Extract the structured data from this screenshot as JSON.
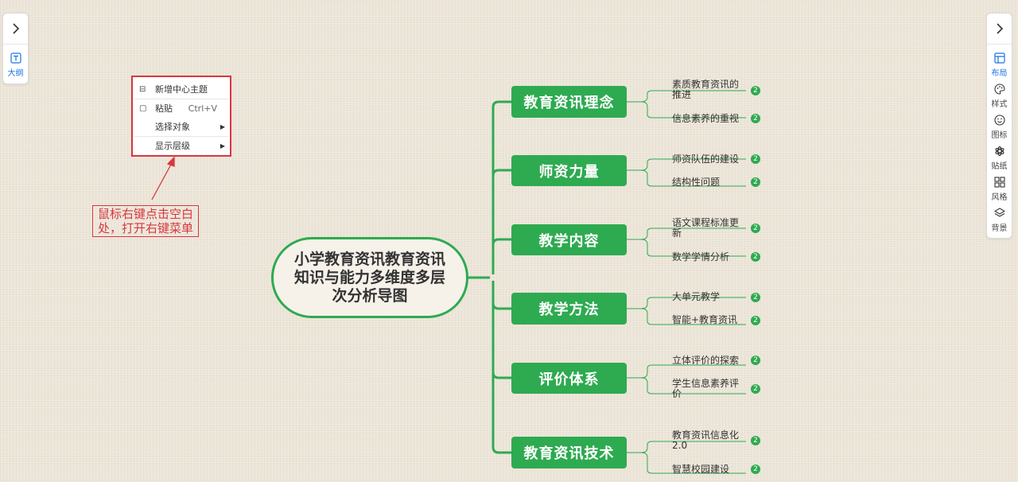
{
  "left_panel": {
    "expand_icon": "chevron-right-icon",
    "outline_label": "大纲"
  },
  "right_panel": {
    "expand_icon": "chevron-right-icon",
    "tools": [
      {
        "label": "布局",
        "icon": "layout-icon",
        "active": true
      },
      {
        "label": "样式",
        "icon": "palette-icon",
        "active": false
      },
      {
        "label": "图标",
        "icon": "smiley-icon",
        "active": false
      },
      {
        "label": "贴纸",
        "icon": "sticker-icon",
        "active": false
      },
      {
        "label": "风格",
        "icon": "grid-icon",
        "active": false
      },
      {
        "label": "背景",
        "icon": "layers-icon",
        "active": false
      }
    ]
  },
  "context_menu": {
    "items": [
      {
        "label": "新增中心主题",
        "icon": "add-topic-icon",
        "shortcut": "",
        "submenu": false
      },
      {
        "label": "粘贴",
        "icon": "paste-icon",
        "shortcut": "Ctrl+V",
        "submenu": false
      },
      {
        "label": "选择对象",
        "icon": "",
        "shortcut": "",
        "submenu": true
      },
      {
        "label": "显示层级",
        "icon": "",
        "shortcut": "",
        "submenu": true
      }
    ]
  },
  "annotation": {
    "line1": "鼠标右键点击空白",
    "line2": "处，打开右键菜单"
  },
  "mindmap": {
    "center": {
      "text": "小学教育资讯教育资讯知识与能力多维度多层次分析导图"
    },
    "accent_color": "#2eaa51",
    "branches": [
      {
        "title": "教育资讯理念",
        "children": [
          {
            "text": "素质教育资讯的推进",
            "badge": "2"
          },
          {
            "text": "信息素养的重视",
            "badge": "2"
          }
        ]
      },
      {
        "title": "师资力量",
        "children": [
          {
            "text": "师资队伍的建设",
            "badge": "2"
          },
          {
            "text": "结构性问题",
            "badge": "2"
          }
        ]
      },
      {
        "title": "教学内容",
        "children": [
          {
            "text": "语文课程标准更新",
            "badge": "2"
          },
          {
            "text": "数学学情分析",
            "badge": "2"
          }
        ]
      },
      {
        "title": "教学方法",
        "children": [
          {
            "text": "大单元教学",
            "badge": "2"
          },
          {
            "text": "智能+教育资讯",
            "badge": "2"
          }
        ]
      },
      {
        "title": "评价体系",
        "children": [
          {
            "text": "立体评价的探索",
            "badge": "2"
          },
          {
            "text": "学生信息素养评价",
            "badge": "2"
          }
        ]
      },
      {
        "title": "教育资讯技术",
        "children": [
          {
            "text": "教育资讯信息化2.0",
            "badge": "2"
          },
          {
            "text": "智慧校园建设",
            "badge": "2"
          }
        ]
      }
    ]
  }
}
